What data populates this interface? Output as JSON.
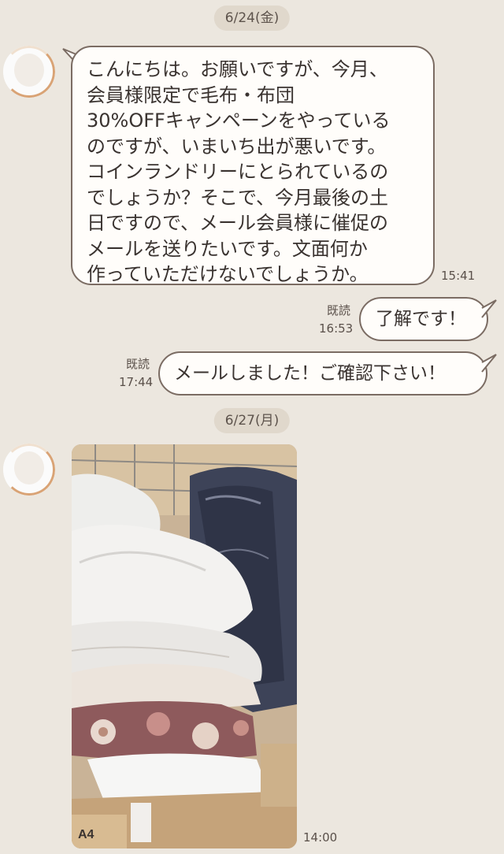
{
  "dates": [
    "6/24(金)",
    "6/27(月)"
  ],
  "messages": {
    "received_1": {
      "lines": [
        "こんにちは。お願いですが、今月、",
        "会員様限定で毛布・布団",
        "30%OFFキャンペーンをやっている",
        "のですが、いまいち出が悪いです。",
        "コインランドリーにとられているの",
        "でしょうか？そこで、今月最後の土",
        "日ですので、メール会員様に催促の",
        "メールを送りたいです。文面何か",
        "作っていただけないでしょうか。"
      ],
      "time": "15:41"
    },
    "sent_1": {
      "text": "了解です！",
      "read": "既読",
      "time": "16:53"
    },
    "sent_2": {
      "text": "メールしました！ご確認下さい！",
      "read": "既読",
      "time": "17:44"
    },
    "received_photo": {
      "time": "14:00",
      "label": "A4"
    }
  },
  "colors": {
    "background": "#ece7df",
    "bubble_fill": "#fffdfa",
    "bubble_border": "#7b6c63",
    "date_pill": "#e0d8cc"
  }
}
